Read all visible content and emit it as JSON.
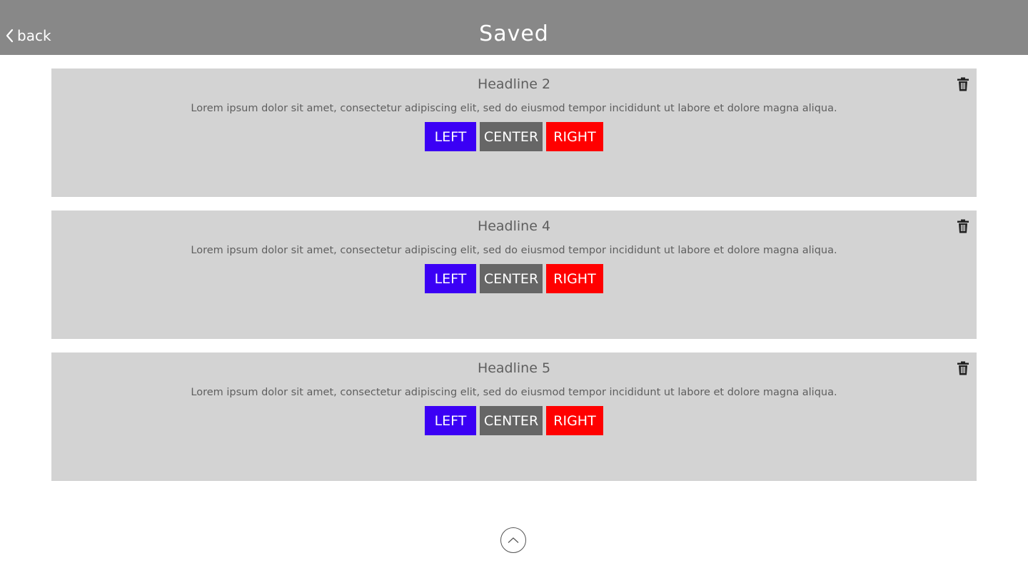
{
  "header": {
    "back_label": "back",
    "title": "Saved",
    "background": "#888888"
  },
  "cards": [
    {
      "headline": "Headline 2",
      "text": "Lorem ipsum dolor sit amet, consectetur adipiscing elit, sed do eiusmod tempor incididunt ut labore et dolore magna aliqua.",
      "buttons": {
        "left": "LEFT",
        "center": "CENTER",
        "right": "RIGHT"
      }
    },
    {
      "headline": "Headline 4",
      "text": "Lorem ipsum dolor sit amet, consectetur adipiscing elit, sed do eiusmod tempor incididunt ut labore et dolore magna aliqua.",
      "buttons": {
        "left": "LEFT",
        "center": "CENTER",
        "right": "RIGHT"
      }
    },
    {
      "headline": "Headline 5",
      "text": "Lorem ipsum dolor sit amet, consectetur adipiscing elit, sed do eiusmod tempor incididunt ut labore et dolore magna aliqua.",
      "buttons": {
        "left": "LEFT",
        "center": "CENTER",
        "right": "RIGHT"
      }
    }
  ],
  "colors": {
    "left_button": "#3b00f5",
    "center_button": "#666666",
    "right_button": "#ff0000",
    "card_background": "#d3d3d3"
  },
  "icons": {
    "back": "chevron-left-icon",
    "delete": "trash-icon",
    "scroll_top": "chevron-up-icon"
  }
}
